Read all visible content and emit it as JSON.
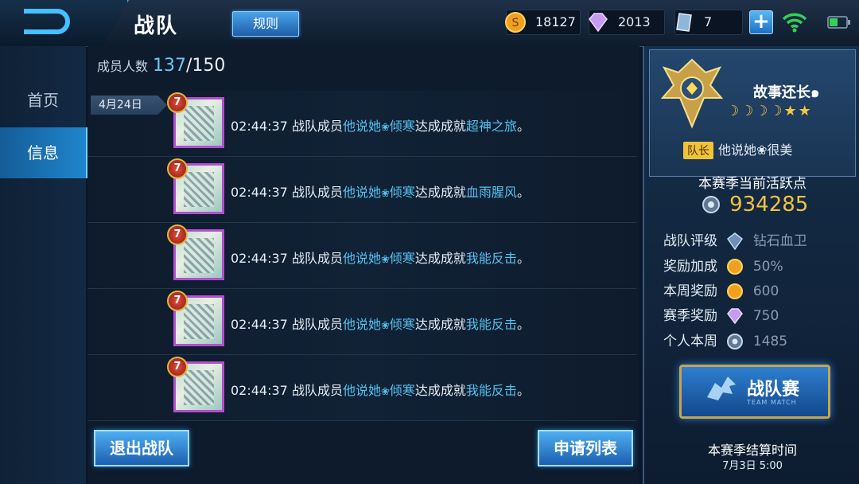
{
  "header": {
    "title": "战队",
    "rules_label": "规则",
    "coins": "18127",
    "diamonds": "2013",
    "vouchers": "7"
  },
  "nav": {
    "items": [
      {
        "label": "首页"
      },
      {
        "label": "信息"
      }
    ]
  },
  "members": {
    "label": "成员人数",
    "current": "137",
    "total": "/150"
  },
  "feed": {
    "date": "4月24日",
    "rows": [
      {
        "level": "7",
        "time": "02:44:37",
        "prefix": "战队成员",
        "name_a": "他说她",
        "flower": "❀",
        "name_b": "倾寒",
        "middle": "达成成就",
        "achievement": "超神之旅",
        "end": "。"
      },
      {
        "level": "7",
        "time": "02:44:37",
        "prefix": "战队成员",
        "name_a": "他说她",
        "flower": "❀",
        "name_b": "倾寒",
        "middle": "达成成就",
        "achievement": "血雨腥风",
        "end": "。"
      },
      {
        "level": "7",
        "time": "02:44:37",
        "prefix": "战队成员",
        "name_a": "他说她",
        "flower": "❀",
        "name_b": "倾寒",
        "middle": "达成成就",
        "achievement": "我能反击",
        "end": "。"
      },
      {
        "level": "7",
        "time": "02:44:37",
        "prefix": "战队成员",
        "name_a": "他说她",
        "flower": "❀",
        "name_b": "倾寒",
        "middle": "达成成就",
        "achievement": "我能反击",
        "end": "。"
      },
      {
        "level": "7",
        "time": "02:44:37",
        "prefix": "战队成员",
        "name_a": "他说她",
        "flower": "❀",
        "name_b": "倾寒",
        "middle": "达成成就",
        "achievement": "我能反击",
        "end": "。"
      }
    ]
  },
  "buttons": {
    "quit": "退出战队",
    "apply_list": "申请列表"
  },
  "team": {
    "name": "故事还长๑",
    "stars": "☽☽☽☽★★",
    "captain_tag": "队长",
    "captain_name": "他说她❀很美",
    "season_title": "本赛季当前活跃点",
    "score": "934285",
    "stats": [
      {
        "label": "战队评级",
        "value": "钻石血卫"
      },
      {
        "label": "奖励加成",
        "value": "50%"
      },
      {
        "label": "本周奖励",
        "value": "600"
      },
      {
        "label": "赛季奖励",
        "value": "750"
      },
      {
        "label": "个人本周",
        "value": "1485"
      }
    ],
    "match_label": "战队赛",
    "match_sub": "TEAM MATCH",
    "settle_title": "本赛季结算时间",
    "settle_time": "7月3日 5:00"
  },
  "colors": {
    "accent": "#56c2f2",
    "gold": "#f2c23e",
    "button_blue": "#1b5fb0"
  }
}
